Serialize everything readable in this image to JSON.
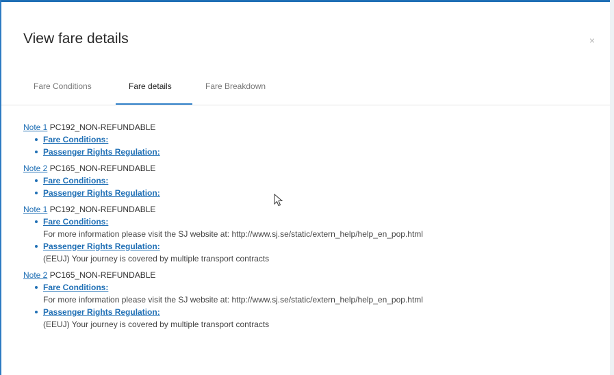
{
  "dialog": {
    "title": "View fare details",
    "close_label": "×"
  },
  "tabs": [
    {
      "label": "Fare Conditions",
      "active": false
    },
    {
      "label": "Fare details",
      "active": true
    },
    {
      "label": "Fare Breakdown",
      "active": false
    }
  ],
  "notes": [
    {
      "link": "Note 1",
      "code": "PC192_NON-REFUNDABLE",
      "items": [
        {
          "label": "Fare Conditions:",
          "desc": ""
        },
        {
          "label": "Passenger Rights Regulation:",
          "desc": ""
        }
      ]
    },
    {
      "link": "Note 2",
      "code": "PC165_NON-REFUNDABLE",
      "items": [
        {
          "label": "Fare Conditions:",
          "desc": ""
        },
        {
          "label": "Passenger Rights Regulation:",
          "desc": ""
        }
      ]
    },
    {
      "link": "Note 1",
      "code": "PC192_NON-REFUNDABLE",
      "items": [
        {
          "label": "Fare Conditions:",
          "desc": "For more information please visit the SJ website at: http://www.sj.se/static/extern_help/help_en_pop.html"
        },
        {
          "label": "Passenger Rights Regulation:",
          "desc": "(EEUJ) Your journey is covered by multiple transport contracts"
        }
      ]
    },
    {
      "link": "Note 2",
      "code": "PC165_NON-REFUNDABLE",
      "items": [
        {
          "label": "Fare Conditions:",
          "desc": "For more information please visit the SJ website at: http://www.sj.se/static/extern_help/help_en_pop.html"
        },
        {
          "label": "Passenger Rights Regulation:",
          "desc": "(EEUJ) Your journey is covered by multiple transport contracts"
        }
      ]
    }
  ],
  "colors": {
    "accent": "#1f6fb5",
    "tab_underline": "#2f80c8"
  }
}
